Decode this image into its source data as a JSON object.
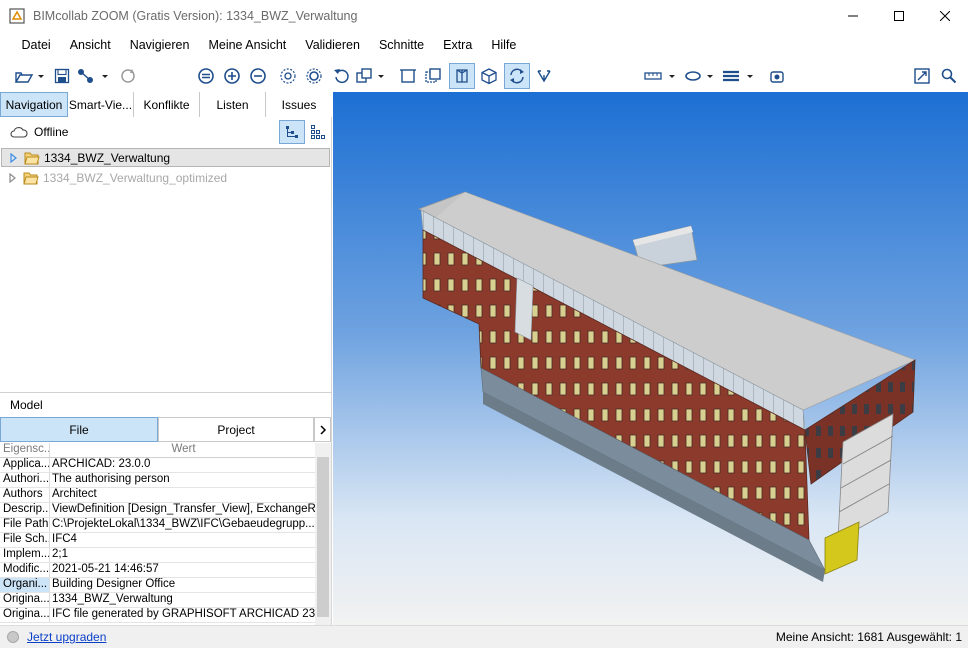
{
  "window": {
    "title": "BIMcollab ZOOM (Gratis Version): 1334_BWZ_Verwaltung"
  },
  "menu": [
    "Datei",
    "Ansicht",
    "Navigieren",
    "Meine Ansicht",
    "Validieren",
    "Schnitte",
    "Extra",
    "Hilfe"
  ],
  "left_tabs": [
    "Navigation",
    "Smart-Vie...",
    "Konflikte",
    "Listen",
    "Issues"
  ],
  "offline_label": "Offline",
  "tree": [
    {
      "label": "1334_BWZ_Verwaltung",
      "selected": true,
      "dim": false
    },
    {
      "label": "1334_BWZ_Verwaltung_optimized",
      "selected": false,
      "dim": true
    }
  ],
  "model": {
    "header": "Model",
    "tabs": [
      "File",
      "Project"
    ],
    "columns": {
      "key": "Eigensc...",
      "value": "Wert"
    },
    "rows": [
      {
        "key": "Applica...",
        "value": "ARCHICAD: 23.0.0"
      },
      {
        "key": "Authori...",
        "value": "The authorising person"
      },
      {
        "key": "Authors",
        "value": "Architect"
      },
      {
        "key": "Descrip...",
        "value": "ViewDefinition [Design_Transfer_View], ExchangeR..."
      },
      {
        "key": "File Path",
        "value": "C:\\ProjekteLokal\\1334_BWZ\\IFC\\Gebaeudegrupp..."
      },
      {
        "key": "File Sch...",
        "value": "IFC4"
      },
      {
        "key": "Implem...",
        "value": "2;1"
      },
      {
        "key": "Modific...",
        "value": "2021-05-21 14:46:57"
      },
      {
        "key": "Organi...",
        "value": "Building Designer Office",
        "selected": true
      },
      {
        "key": "Origina...",
        "value": "1334_BWZ_Verwaltung"
      },
      {
        "key": "Origina...",
        "value": "IFC file generated by GRAPHISOFT ARCHICAD 23..."
      }
    ]
  },
  "status": {
    "upgrade_link": "Jetzt upgraden",
    "right_text": "Meine Ansicht: 1681  Ausgewählt: 1"
  },
  "colors": {
    "accent": "#cce4f7",
    "accent_border": "#7aa8d6",
    "link": "#0a3fc8",
    "toolbar_icon": "#1f4e8c"
  }
}
